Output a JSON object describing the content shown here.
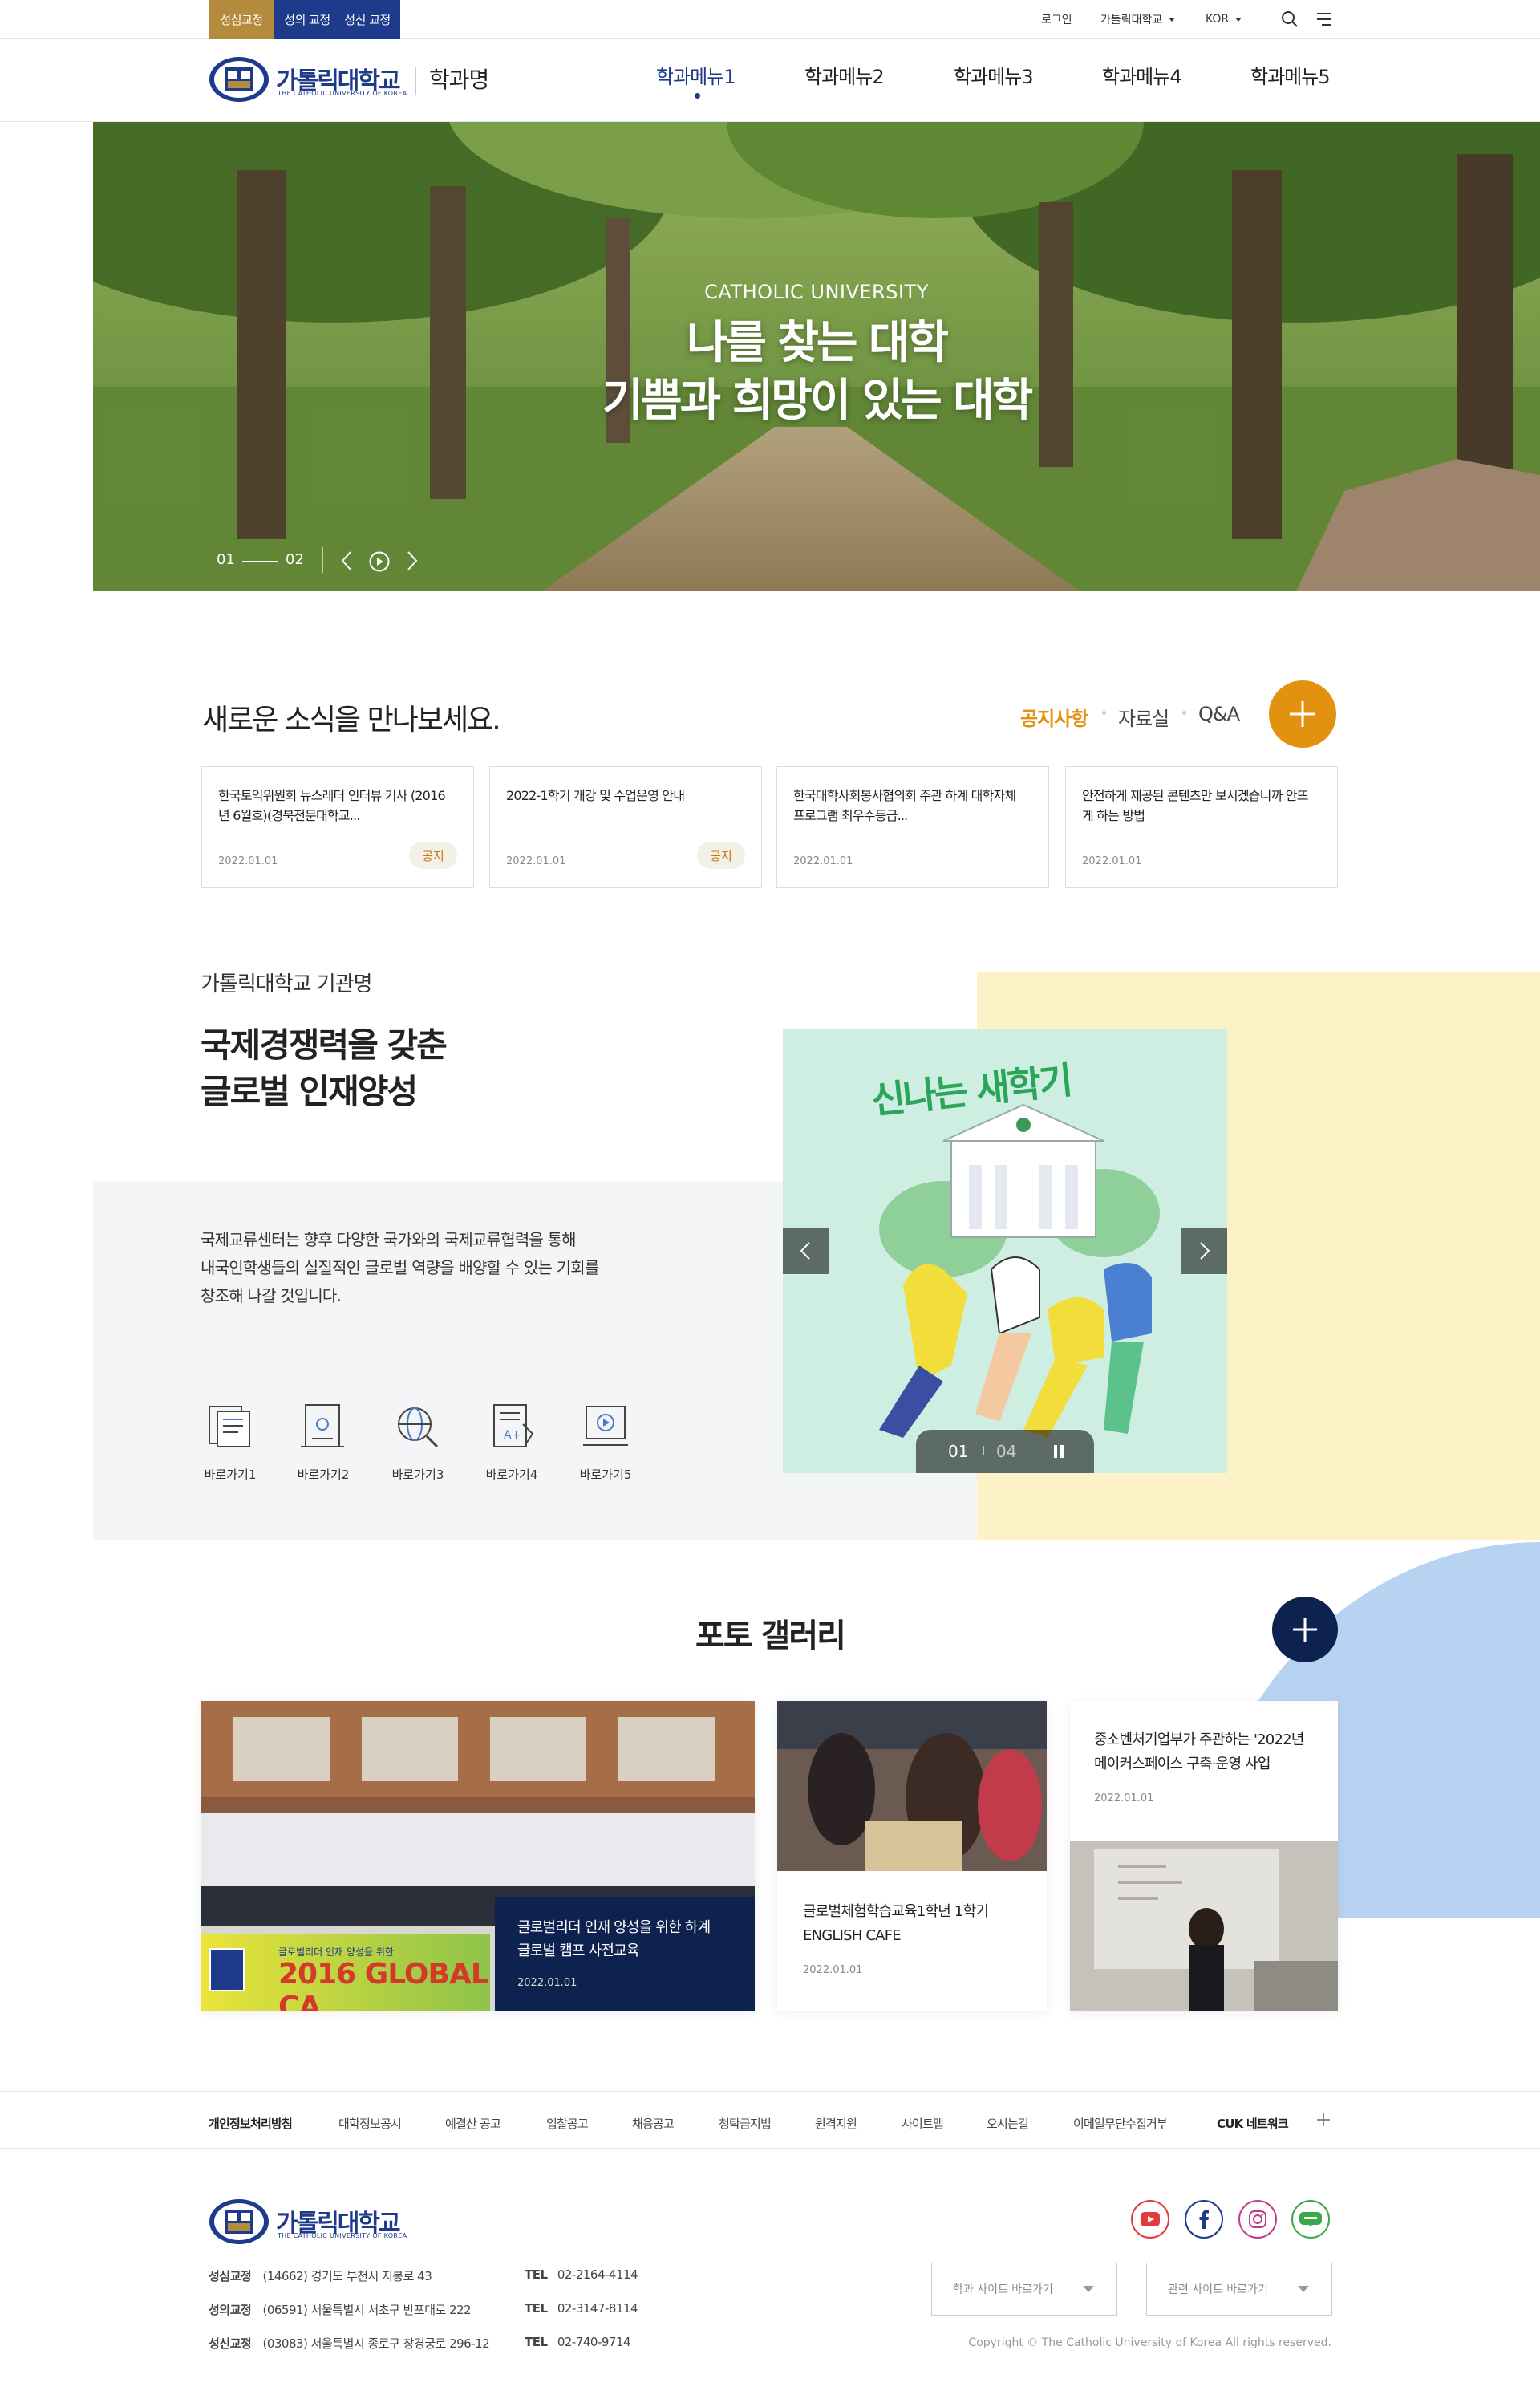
{
  "top_bar": {
    "campus_tabs": [
      {
        "label": "성심교정",
        "color": "#b48a3c"
      },
      {
        "label": "성의 교정",
        "color": "#1e3a8a"
      },
      {
        "label": "성신 교정",
        "color": "#1e3a8a"
      }
    ],
    "login": "로그인",
    "univ_menu": "가톨릭대학교",
    "lang": "KOR"
  },
  "header": {
    "logo_text": "가톨릭대학교",
    "logo_sub": "THE CATHOLIC UNIVERSITY OF KOREA",
    "dept": "학과명",
    "nav": [
      "학과메뉴1",
      "학과메뉴2",
      "학과메뉴3",
      "학과메뉴4",
      "학과메뉴5"
    ]
  },
  "hero": {
    "eyebrow": "CATHOLIC UNIVERSITY",
    "title_line1": "나를 찾는 대학",
    "title_line2": "기쁨과 희망이 있는 대학",
    "page_current": "01",
    "page_total": "02"
  },
  "news": {
    "title": "새로운 소식을 만나보세요.",
    "tabs": [
      "공지사항",
      "자료실",
      "Q&A"
    ],
    "items": [
      {
        "title": "한국토익위원회 뉴스레터 인터뷰 기사 (2016년 6월호)(경북전문대학교...",
        "date": "2022.01.01",
        "badge": "공지"
      },
      {
        "title": "2022-1학기 개강 및 수업운영 안내",
        "date": "2022.01.01",
        "badge": "공지"
      },
      {
        "title": "한국대학사회봉사협의회 주관 하계 대학자체 프로그램 최우수등급...",
        "date": "2022.01.01",
        "badge": ""
      },
      {
        "title": "안전하게 제공된 콘텐츠만 보시겠습니까 안뜨게 하는 방법",
        "date": "2022.01.01",
        "badge": ""
      }
    ]
  },
  "intro": {
    "org": "가톨릭대학교 기관명",
    "headline1": "국제경쟁력을 갖춘",
    "headline2": "글로벌 인재양성",
    "desc1": "국제교류센터는 향후 다양한 국가와의 국제교류협력을 통해",
    "desc2": "내국인학생들의 실질적인 글로벌 역량을 배양할 수 있는 기회를",
    "desc3": "창조해 나갈 것입니다.",
    "quick_links": [
      "바로가기1",
      "바로가기2",
      "바로가기3",
      "바로가기4",
      "바로가기5"
    ],
    "slider_text": "신나는 새학기",
    "slider_current": "01",
    "slider_total": "04"
  },
  "gallery": {
    "title": "포토 갤러리",
    "items": [
      {
        "title": "글로벌리더 인재 양성을 위한 하계 글로벌 캠프 사전교육",
        "date": "2022.01.01",
        "banner": "2016 GLOBAL CA",
        "banner_sub": "글로벌리더 인재 양성을 위한"
      },
      {
        "title": "글로벌체험학습교육1학년 1학기 ENGLISH CAFE",
        "date": "2022.01.01"
      },
      {
        "title": "중소벤처기업부가 주관하는 '2022년 메이커스페이스 구축·운영 사업",
        "date": "2022.01.01"
      }
    ]
  },
  "footer": {
    "links": [
      "개인정보처리방침",
      "대학정보공시",
      "예결산 공고",
      "입찰공고",
      "채용공고",
      "청탁금지법",
      "원격지원",
      "사이트맵",
      "오시는길",
      "이메일무단수집거부",
      "CUK 네트워크"
    ],
    "logo_text": "가톨릭대학교",
    "logo_sub": "THE CATHOLIC UNIVERSITY OF KOREA",
    "campuses": [
      {
        "name": "성심교정",
        "addr": "(14662) 경기도 부천시 지봉로 43",
        "tel_label": "TEL",
        "tel": "02-2164-4114"
      },
      {
        "name": "성의교정",
        "addr": "(06591) 서울특별시 서초구 반포대로 222",
        "tel_label": "TEL",
        "tel": "02-3147-8114"
      },
      {
        "name": "성신교정",
        "addr": "(03083) 서울특별시 종로구 창경궁로 296-12",
        "tel_label": "TEL",
        "tel": "02-740-9714"
      }
    ],
    "select1": "학과 사이트 바로가기",
    "select2": "관련 사이트 바로가기",
    "copyright": "Copyright © The Catholic University of Korea All rights reserved.",
    "sns": [
      {
        "name": "youtube",
        "color": "#e23b3b"
      },
      {
        "name": "facebook",
        "color": "#1e3a8a"
      },
      {
        "name": "instagram",
        "color": "#c23b8f"
      },
      {
        "name": "blog",
        "color": "#3aa84a"
      }
    ]
  },
  "colors": {
    "accent": "#e3920f",
    "navy": "#0e2250",
    "cream": "#fdf1c7",
    "light_blue": "#b8d3f1",
    "gray_bg": "#f4f5f7"
  }
}
